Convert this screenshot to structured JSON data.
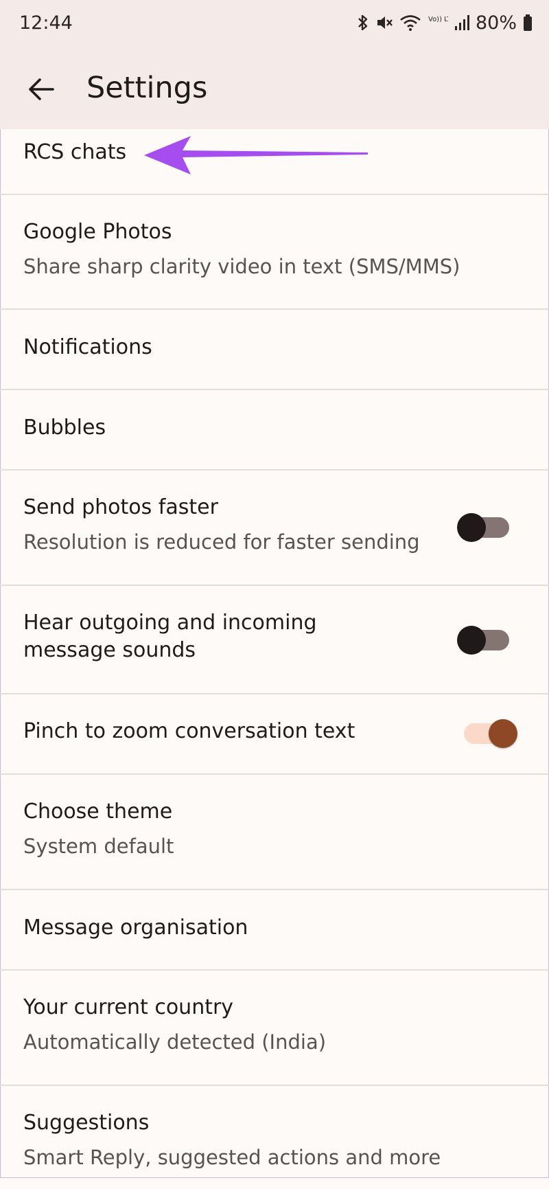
{
  "status_bar": {
    "time": "12:44",
    "battery": "80%",
    "icons": [
      "bluetooth-icon",
      "mute-icon",
      "wifi-icon",
      "volte-icon",
      "signal-icon",
      "battery-icon"
    ],
    "volte_label": "Vo)) LTE1"
  },
  "appbar": {
    "title": "Settings",
    "back_icon": "back-arrow-icon"
  },
  "rows": [
    {
      "title": "RCS chats"
    },
    {
      "title": "Google Photos",
      "subtitle": "Share sharp clarity video in text (SMS/MMS)"
    },
    {
      "title": "Notifications"
    },
    {
      "title": "Bubbles"
    },
    {
      "title": "Send photos faster",
      "subtitle": "Resolution is reduced for faster sending",
      "toggle": "off"
    },
    {
      "title": "Hear outgoing and incoming message sounds",
      "toggle": "off"
    },
    {
      "title": "Pinch to zoom conversation text",
      "toggle": "on"
    },
    {
      "title": "Choose theme",
      "subtitle": "System default"
    },
    {
      "title": "Message organisation"
    },
    {
      "title": "Your current country",
      "subtitle": "Automatically detected (India)"
    },
    {
      "title": "Suggestions",
      "subtitle": "Smart Reply, suggested actions and more"
    }
  ],
  "annotation": {
    "arrow_color": "#a64df0"
  },
  "colors": {
    "background": "#fefaf8",
    "header": "#f4ebe8",
    "toggle_on_knob": "#8f4825",
    "toggle_on_track": "#fbd9c8",
    "toggle_off_knob": "#1f1a19",
    "toggle_off_track": "#857572"
  }
}
